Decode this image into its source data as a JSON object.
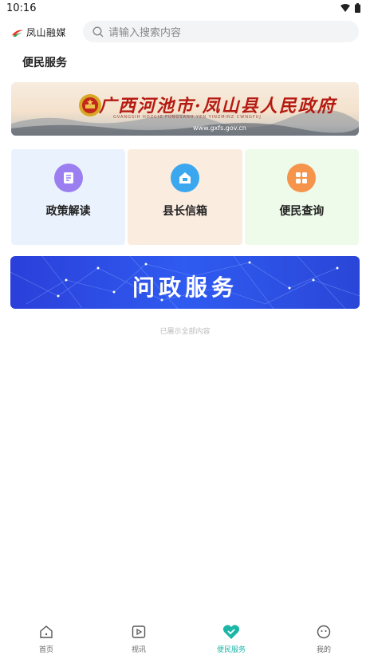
{
  "status": {
    "time": "10:16"
  },
  "header": {
    "logo_text": "凤山融媒",
    "search_placeholder": "请输入搜索内容"
  },
  "section": {
    "title": "便民服务"
  },
  "banner": {
    "title": "广西河池市·凤山县人民政府",
    "subtitle": "GVANGSIH HOZCIZ FUNGSANH YEN YINZMINZ CWNGFUJ",
    "url": "www.gxfs.gov.cn"
  },
  "grid": {
    "items": [
      {
        "label": "政策解读",
        "icon": "document-icon",
        "color": "#9b7ef0"
      },
      {
        "label": "县长信箱",
        "icon": "mailbox-icon",
        "color": "#3aa7ef"
      },
      {
        "label": "便民查询",
        "icon": "grid-icon",
        "color": "#f5944a"
      }
    ]
  },
  "service_banner": {
    "title": "问政服务"
  },
  "footer_note": "已展示全部内容",
  "tabbar": {
    "items": [
      {
        "label": "首页",
        "icon": "home-icon"
      },
      {
        "label": "视讯",
        "icon": "play-icon"
      },
      {
        "label": "便民服务",
        "icon": "heart-icon",
        "active": true
      },
      {
        "label": "我的",
        "icon": "face-icon"
      }
    ],
    "active_color": "#1bb6a7"
  }
}
